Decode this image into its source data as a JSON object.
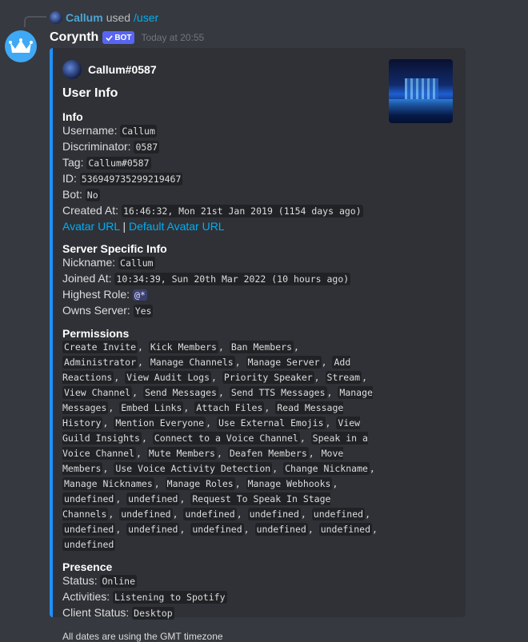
{
  "reply": {
    "user": "Callum",
    "used": "used",
    "command": "/user"
  },
  "message": {
    "username": "Corynth",
    "bot_tag": "BOT",
    "timestamp": "Today at 20:55"
  },
  "embed": {
    "author": "Callum#0587",
    "title": "User Info",
    "info": {
      "title": "Info",
      "username_label": "Username:",
      "username": "Callum",
      "discriminator_label": "Discriminator:",
      "discriminator": "0587",
      "tag_label": "Tag:",
      "tag": "Callum#0587",
      "id_label": "ID:",
      "id": "536949735299219467",
      "bot_label": "Bot:",
      "bot": "No",
      "created_label": "Created At:",
      "created": "16:46:32, Mon 21st Jan 2019 (1154 days ago)",
      "avatar_url": "Avatar URL",
      "separator": "|",
      "default_avatar_url": "Default Avatar URL"
    },
    "server": {
      "title": "Server Specific Info",
      "nickname_label": "Nickname:",
      "nickname": "Callum",
      "joined_label": "Joined At:",
      "joined": "10:34:39, Sun 20th Mar 2022 (10 hours ago)",
      "role_label": "Highest Role:",
      "role": "@*",
      "owns_label": "Owns Server:",
      "owns": "Yes"
    },
    "permissions": {
      "title": "Permissions",
      "items": [
        "Create Invite",
        "Kick Members",
        "Ban Members",
        "Administrator",
        "Manage Channels",
        "Manage Server",
        "Add Reactions",
        "View Audit Logs",
        "Priority Speaker",
        "Stream",
        "View Channel",
        "Send Messages",
        "Send TTS Messages",
        "Manage Messages",
        "Embed Links",
        "Attach Files",
        "Read Message History",
        "Mention Everyone",
        "Use External Emojis",
        "View Guild Insights",
        "Connect to a Voice Channel",
        "Speak in a Voice Channel",
        "Mute Members",
        "Deafen Members",
        "Move Members",
        "Use Voice Activity Detection",
        "Change Nickname",
        "Manage Nicknames",
        "Manage Roles",
        "Manage Webhooks",
        "undefined",
        "undefined",
        "Request To Speak In Stage Channels",
        "undefined",
        "undefined",
        "undefined",
        "undefined",
        "undefined",
        "undefined",
        "undefined",
        "undefined",
        "undefined",
        "undefined"
      ]
    },
    "presence": {
      "title": "Presence",
      "status_label": "Status:",
      "status": "Online",
      "activities_label": "Activities:",
      "activities": "Listening to Spotify",
      "client_label": "Client Status:",
      "client": "Desktop"
    },
    "footer": "All dates are using the GMT timezone"
  },
  "colors": {
    "embed_accent": "#1e90ff",
    "background": "#36393f",
    "embed_bg": "#2f3136",
    "link": "#00aff4",
    "bot_tag": "#5865f2"
  },
  "icons": [
    "reply-avatar-icon",
    "crown-icon",
    "verified-check-icon",
    "author-avatar-icon",
    "thumbnail-image"
  ]
}
